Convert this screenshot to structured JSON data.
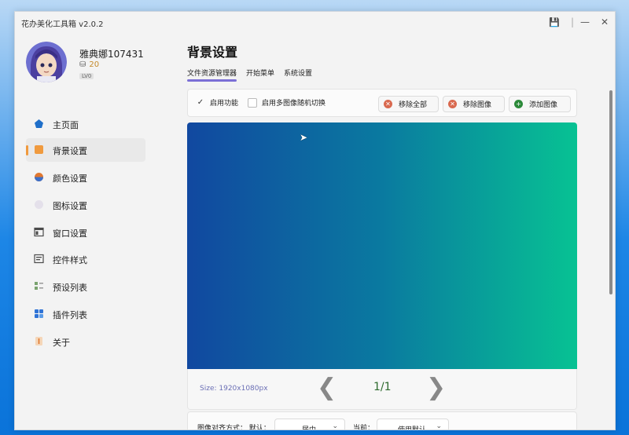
{
  "window": {
    "title": "花办美化工具箱 v2.0.2"
  },
  "profile": {
    "username": "雅典娜107431",
    "coins": "20",
    "level": "LV0"
  },
  "sidebar": {
    "items": [
      {
        "label": "主页面",
        "icon": "home-icon",
        "color": "#1f6fc9"
      },
      {
        "label": "背景设置",
        "icon": "background-icon",
        "color": "#f09a3e",
        "active": true
      },
      {
        "label": "颜色设置",
        "icon": "palette-icon",
        "color": "#e0772f"
      },
      {
        "label": "图标设置",
        "icon": "icon-settings-icon",
        "color": "#e4e0ea"
      },
      {
        "label": "窗口设置",
        "icon": "window-icon",
        "color": "#4b4b4b"
      },
      {
        "label": "控件样式",
        "icon": "controls-icon",
        "color": "#4b4b4b"
      },
      {
        "label": "预设列表",
        "icon": "preset-icon",
        "color": "#7aa36f"
      },
      {
        "label": "插件列表",
        "icon": "plugin-icon",
        "color": "#2f73d6"
      },
      {
        "label": "关于",
        "icon": "info-icon",
        "color": "#f09a3e"
      }
    ]
  },
  "main": {
    "title": "背景设置",
    "tabs": [
      {
        "label": "文件资源管理器",
        "active": true
      },
      {
        "label": "开始菜单",
        "active": false
      },
      {
        "label": "系统设置",
        "active": false
      }
    ],
    "toolbar": {
      "enable_label": "启用功能",
      "enable_checked": true,
      "random_label": "启用多图像随机切换",
      "random_checked": false,
      "remove_all_label": "移除全部",
      "remove_image_label": "移除图像",
      "add_image_label": "添加图像"
    },
    "preview": {
      "size_text": "Size: 1920x1080px",
      "page_indicator": "1/1",
      "gradient": [
        "#1148a0",
        "#07c293"
      ]
    },
    "align": {
      "label": "图像对齐方式：  默认：",
      "default_value": "居中",
      "current_label": "当前：",
      "current_value": "使用默认"
    }
  }
}
